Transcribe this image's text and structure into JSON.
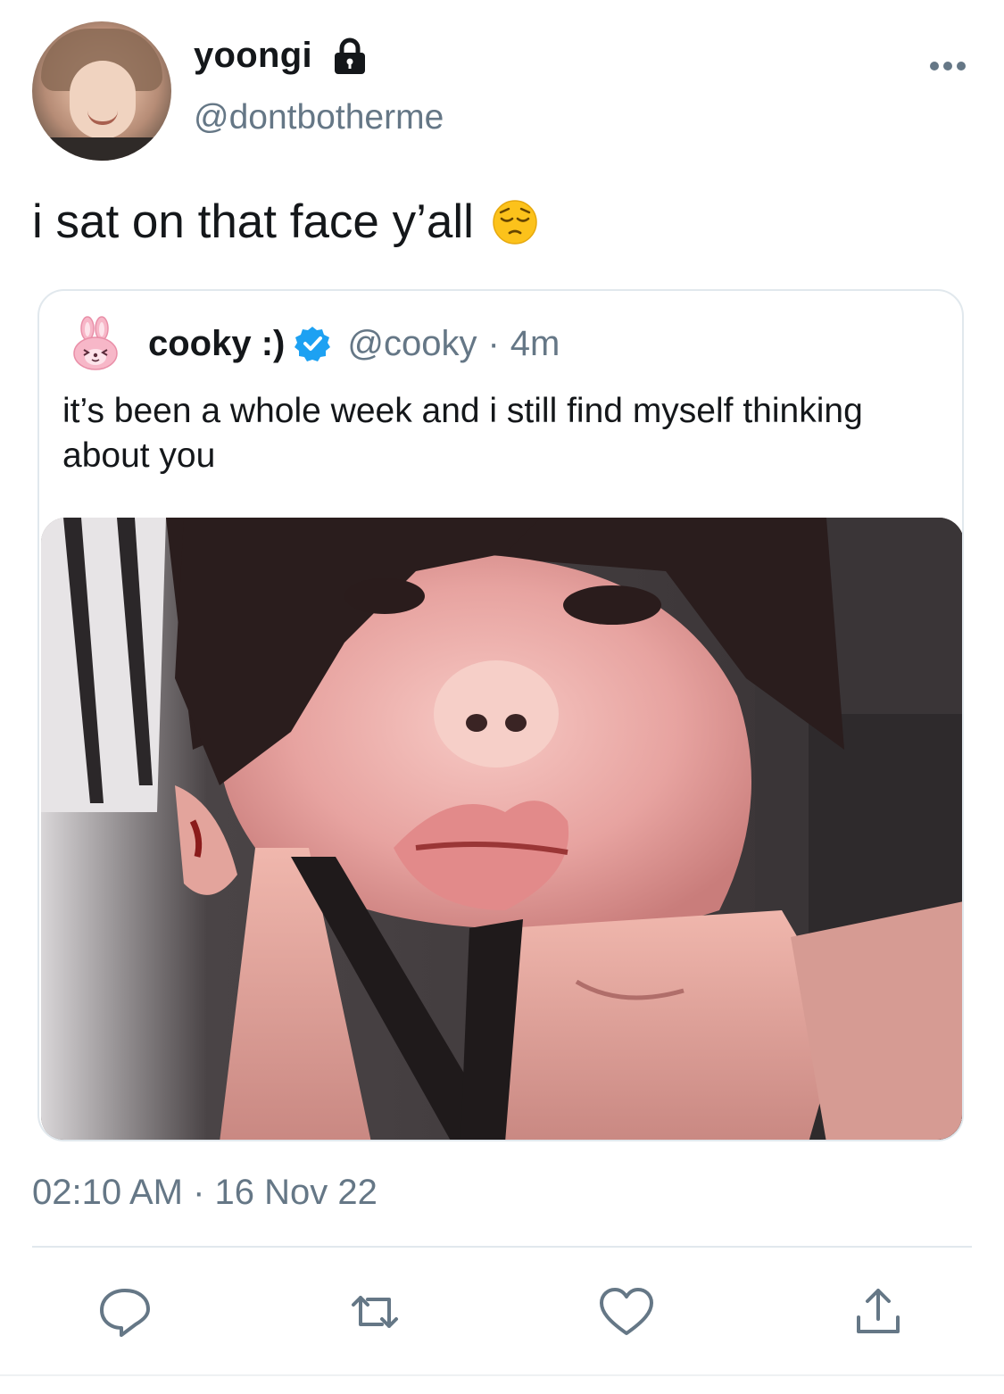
{
  "author": {
    "display_name": "yoongi",
    "handle": "@dontbotherme",
    "protected": true,
    "avatar_icon": "profile-photo"
  },
  "tweet": {
    "text": "i sat on that face y’all",
    "emoji_icon": "pensive-face-emoji",
    "timestamp": "02:10 AM · 16 Nov 22"
  },
  "quoted_tweet": {
    "display_name": "cooky :)",
    "verified": true,
    "handle": "@cooky",
    "separator": "·",
    "time": "4m",
    "text": "it’s been a whole week and i still find myself thinking about you",
    "avatar_icon": "pink-bunny-icon",
    "media_icon": "photo"
  },
  "actions": [
    {
      "name": "reply",
      "icon": "reply-icon"
    },
    {
      "name": "retweet",
      "icon": "retweet-icon"
    },
    {
      "name": "like",
      "icon": "heart-icon"
    },
    {
      "name": "share",
      "icon": "share-icon"
    }
  ],
  "colors": {
    "text_primary": "#14171a",
    "text_secondary": "#657786",
    "border": "#e1e8ed",
    "verified_blue": "#1da1f2",
    "icon_gray": "#657786"
  }
}
